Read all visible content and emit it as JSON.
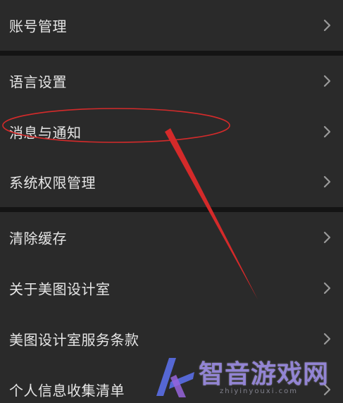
{
  "settings": {
    "items": [
      {
        "label": "账号管理"
      },
      {
        "label": "语言设置"
      },
      {
        "label": "消息与通知"
      },
      {
        "label": "系统权限管理"
      },
      {
        "label": "清除缓存"
      },
      {
        "label": "关于美图设计室"
      },
      {
        "label": "美图设计室服务条款"
      },
      {
        "label": "个人信息收集清单"
      }
    ]
  },
  "watermark": {
    "text": "智音游戏网",
    "url": "zhiyinyouxi.com"
  },
  "colors": {
    "background": "#2a2a2a",
    "divider": "#141414",
    "text": "#e6e6e6",
    "chevron": "#9a9a9a",
    "annotation": "#d42a2a"
  },
  "icons": {
    "chevron": "chevron-right-icon",
    "watermark_logo": "watermark-logo-icon"
  }
}
